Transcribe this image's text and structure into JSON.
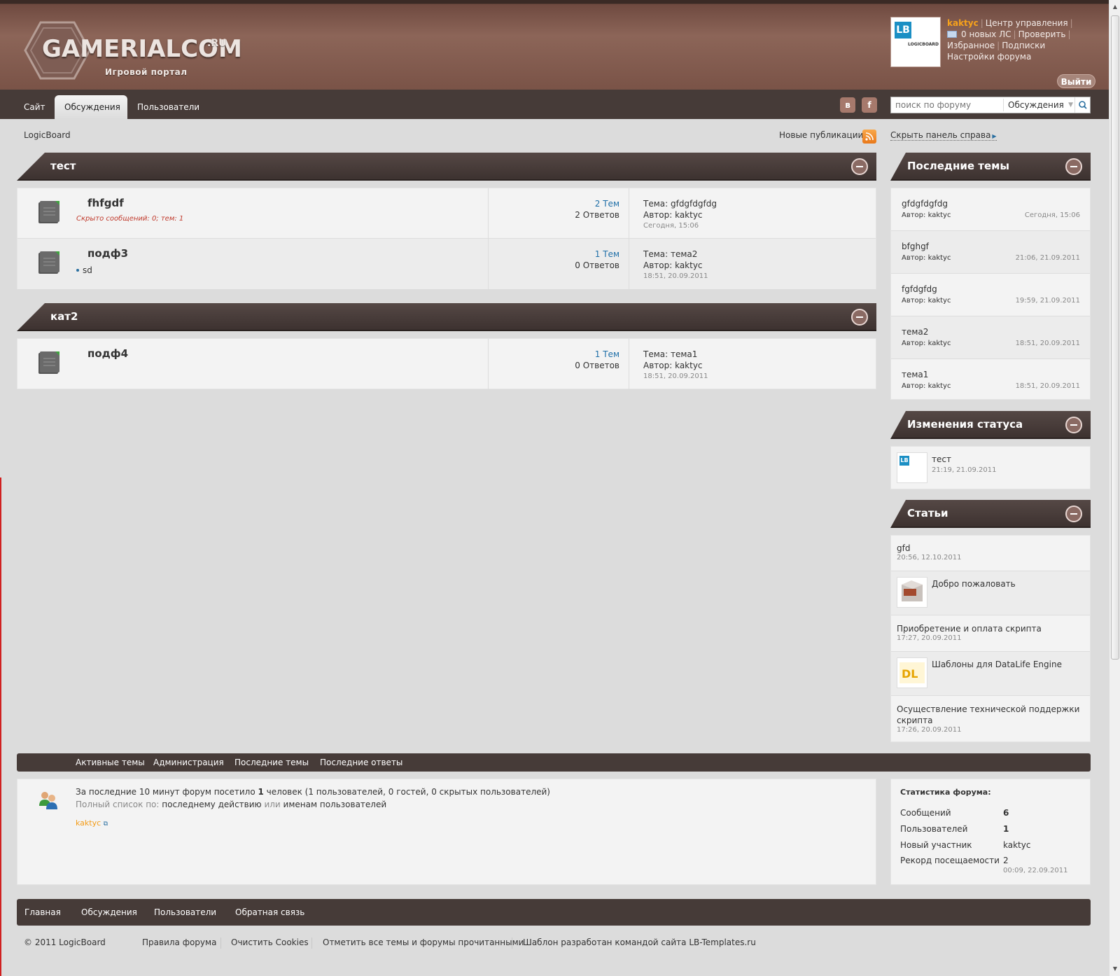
{
  "header": {
    "logo_text": "GAMERIALCOM",
    "logo_tld": ".RU",
    "tagline": "Игровой портал",
    "avatar_label": "LB",
    "avatar_sub": "LOGICBOARD",
    "username": "kaktyc",
    "control_panel": "Центр управления",
    "new_pm": "0 новых ЛС",
    "check": "Проверить",
    "favorites": "Избранное",
    "subscriptions": "Подписки",
    "forum_settings": "Настройки форума",
    "logout": "Выйти"
  },
  "nav": {
    "tabs": [
      "Сайт",
      "Обсуждения",
      "Пользователи"
    ],
    "active": "Обсуждения",
    "vk": "в",
    "fb": "f",
    "search_placeholder": "поиск по форуму",
    "search_scope": "Обсуждения"
  },
  "crumb": {
    "path": "LogicBoard",
    "new_publications": "Новые публикации",
    "hide_panel": "Скрыть панель справа"
  },
  "categories": [
    {
      "title": "тест",
      "forums": [
        {
          "name": "fhfgdf",
          "note": "Скрыто сообщений: 0; тем: 1",
          "sub": "",
          "topics": "2 Тем",
          "replies": "2 Ответов",
          "last_topic": "Тема:  gfdgfdgfdg",
          "last_author": "Автор: kaktyc",
          "last_date": "Сегодня, 15:06"
        },
        {
          "name": "подф3",
          "note": "",
          "sub": "sd",
          "topics": "1 Тем",
          "replies": "0 Ответов",
          "last_topic": "Тема:  тема2",
          "last_author": "Автор: kaktyc",
          "last_date": "18:51, 20.09.2011"
        }
      ]
    },
    {
      "title": "кат2",
      "forums": [
        {
          "name": "подф4",
          "note": "",
          "sub": "",
          "topics": "1 Тем",
          "replies": "0 Ответов",
          "last_topic": "Тема:  тема1",
          "last_author": "Автор: kaktyc",
          "last_date": "18:51, 20.09.2011"
        }
      ]
    }
  ],
  "sidebar": {
    "latest_title": "Последние темы",
    "latest": [
      {
        "title": "gfdgfdgfdg",
        "author": "Автор: kaktyc",
        "date": "Сегодня, 15:06"
      },
      {
        "title": "bfghgf",
        "author": "Автор: kaktyc",
        "date": "21:06, 21.09.2011"
      },
      {
        "title": "fgfdgfdg",
        "author": "Автор: kaktyc",
        "date": "19:59, 21.09.2011"
      },
      {
        "title": "тема2",
        "author": "Автор: kaktyc",
        "date": "18:51, 20.09.2011"
      },
      {
        "title": "тема1",
        "author": "Автор: kaktyc",
        "date": "18:51, 20.09.2011"
      }
    ],
    "status_title": "Изменения статуса",
    "status": {
      "text": "тест",
      "date": "21:19, 21.09.2011",
      "avatar_label": "LB",
      "avatar_sub": "LOGICBOARD"
    },
    "articles_title": "Статьи",
    "articles": [
      {
        "title": "gfd",
        "date": "20:56, 12.10.2011",
        "thumb": false
      },
      {
        "title": "Добро пожаловать",
        "date": "",
        "thumb": true
      },
      {
        "title": "Приобретение и оплата скрипта",
        "date": "17:27, 20.09.2011",
        "thumb": false
      },
      {
        "title": "Шаблоны для DataLife Engine",
        "date": "",
        "thumb": true
      },
      {
        "title": "Осуществление технической поддержки скрипта",
        "date": "17:26, 20.09.2011",
        "thumb": false
      }
    ]
  },
  "stats_bar": {
    "links": [
      "Активные темы",
      "Администрация",
      "Последние темы",
      "Последние ответы"
    ]
  },
  "online": {
    "line1_a": "За последние 10 минут форум посетило ",
    "line1_count": "1",
    "line1_b": " человек (1 пользователей, 0 гостей, 0 скрытых пользователей)",
    "line2_a": "Полный список по: ",
    "line2_link1": "последнему действию",
    "line2_or": " или ",
    "line2_link2": "именам пользователей",
    "user": "kaktyc"
  },
  "forum_stats": {
    "title": "Статистика форума:",
    "rows": [
      {
        "label": "Сообщений",
        "value": "6"
      },
      {
        "label": "Пользователей",
        "value": "1"
      },
      {
        "label": "Новый участник",
        "value": "kaktyc"
      },
      {
        "label": "Рекорд посещаемости",
        "value": "2"
      }
    ],
    "record_date": "00:09, 22.09.2011"
  },
  "footer": {
    "nav": [
      "Главная",
      "Обсуждения",
      "Пользователи",
      "Обратная связь"
    ],
    "copyright": "© 2011 LogicBoard",
    "links": [
      "Правила форума",
      "Очистить Cookies",
      "Отметить все темы и форумы прочитанными",
      "Шаблон разработан командой сайта LB-Templates.ru"
    ]
  },
  "colors": {
    "header_brown": "#8c6558",
    "dark_bar": "#463b38",
    "link_blue": "#1f6fa8",
    "username_orange": "#f7a21b",
    "hidden_note_red": "#c0392b"
  }
}
